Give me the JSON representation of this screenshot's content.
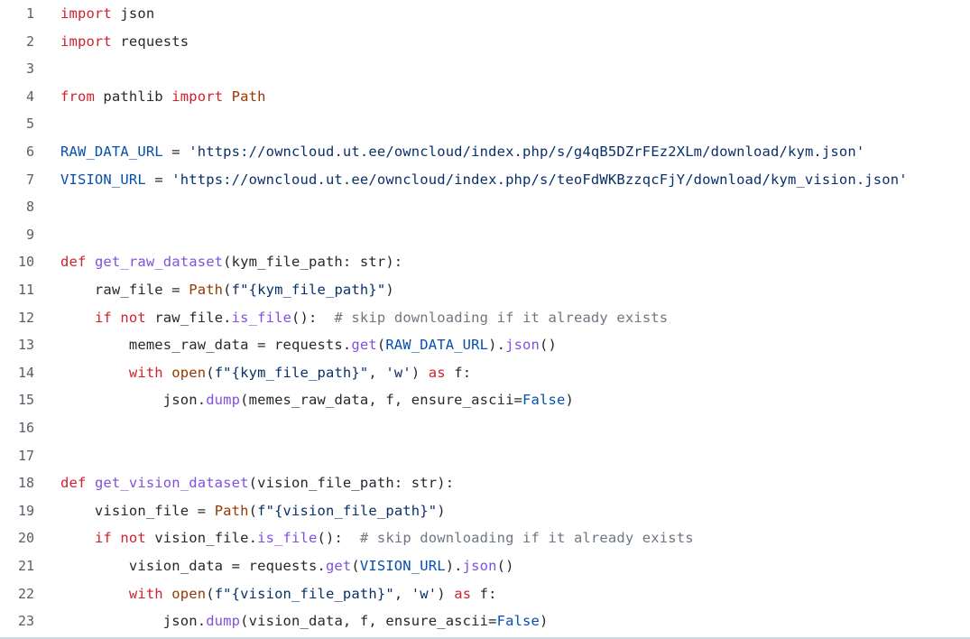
{
  "code_view": {
    "lines": [
      {
        "number": "1",
        "tokens": [
          {
            "text": "import",
            "kind": "keyword"
          },
          {
            "text": " json",
            "kind": "plain"
          }
        ]
      },
      {
        "number": "2",
        "tokens": [
          {
            "text": "import",
            "kind": "keyword"
          },
          {
            "text": " requests",
            "kind": "plain"
          }
        ]
      },
      {
        "number": "3",
        "tokens": []
      },
      {
        "number": "4",
        "tokens": [
          {
            "text": "from",
            "kind": "keyword"
          },
          {
            "text": " pathlib ",
            "kind": "plain"
          },
          {
            "text": "import",
            "kind": "keyword"
          },
          {
            "text": " Path",
            "kind": "builtin"
          }
        ]
      },
      {
        "number": "5",
        "tokens": []
      },
      {
        "number": "6",
        "tokens": [
          {
            "text": "RAW_DATA_URL",
            "kind": "constant"
          },
          {
            "text": " = ",
            "kind": "plain"
          },
          {
            "text": "'https://owncloud.ut.ee/owncloud/index.php/s/g4qB5DZrFEz2XLm/download/kym.json'",
            "kind": "string"
          }
        ]
      },
      {
        "number": "7",
        "tokens": [
          {
            "text": "VISION_URL",
            "kind": "constant"
          },
          {
            "text": " = ",
            "kind": "plain"
          },
          {
            "text": "'https://owncloud.ut.ee/owncloud/index.php/s/teoFdWKBzzqcFjY/download/kym_vision.json'",
            "kind": "string"
          }
        ]
      },
      {
        "number": "8",
        "tokens": []
      },
      {
        "number": "9",
        "tokens": []
      },
      {
        "number": "10",
        "tokens": [
          {
            "text": "def",
            "kind": "keyword"
          },
          {
            "text": " ",
            "kind": "plain"
          },
          {
            "text": "get_raw_dataset",
            "kind": "function"
          },
          {
            "text": "(kym_file_path: str):",
            "kind": "plain"
          }
        ]
      },
      {
        "number": "11",
        "tokens": [
          {
            "text": "    raw_file = ",
            "kind": "plain"
          },
          {
            "text": "Path",
            "kind": "builtin"
          },
          {
            "text": "(",
            "kind": "plain"
          },
          {
            "text": "f\"{kym_file_path}\"",
            "kind": "string"
          },
          {
            "text": ")",
            "kind": "plain"
          }
        ]
      },
      {
        "number": "12",
        "tokens": [
          {
            "text": "    ",
            "kind": "plain"
          },
          {
            "text": "if",
            "kind": "keyword"
          },
          {
            "text": " ",
            "kind": "plain"
          },
          {
            "text": "not",
            "kind": "keyword"
          },
          {
            "text": " raw_file.",
            "kind": "plain"
          },
          {
            "text": "is_file",
            "kind": "function"
          },
          {
            "text": "():  ",
            "kind": "plain"
          },
          {
            "text": "# skip downloading if it already exists",
            "kind": "comment"
          }
        ]
      },
      {
        "number": "13",
        "tokens": [
          {
            "text": "        memes_raw_data = requests.",
            "kind": "plain"
          },
          {
            "text": "get",
            "kind": "function"
          },
          {
            "text": "(",
            "kind": "plain"
          },
          {
            "text": "RAW_DATA_URL",
            "kind": "constant"
          },
          {
            "text": ").",
            "kind": "plain"
          },
          {
            "text": "json",
            "kind": "function"
          },
          {
            "text": "()",
            "kind": "plain"
          }
        ]
      },
      {
        "number": "14",
        "tokens": [
          {
            "text": "        ",
            "kind": "plain"
          },
          {
            "text": "with",
            "kind": "keyword"
          },
          {
            "text": " ",
            "kind": "plain"
          },
          {
            "text": "open",
            "kind": "builtin"
          },
          {
            "text": "(",
            "kind": "plain"
          },
          {
            "text": "f\"{kym_file_path}\"",
            "kind": "string"
          },
          {
            "text": ", ",
            "kind": "plain"
          },
          {
            "text": "'w'",
            "kind": "string"
          },
          {
            "text": ") ",
            "kind": "plain"
          },
          {
            "text": "as",
            "kind": "keyword"
          },
          {
            "text": " f:",
            "kind": "plain"
          }
        ]
      },
      {
        "number": "15",
        "tokens": [
          {
            "text": "            json.",
            "kind": "plain"
          },
          {
            "text": "dump",
            "kind": "function"
          },
          {
            "text": "(memes_raw_data, f, ensure_ascii=",
            "kind": "plain"
          },
          {
            "text": "False",
            "kind": "constant"
          },
          {
            "text": ")",
            "kind": "plain"
          }
        ]
      },
      {
        "number": "16",
        "tokens": []
      },
      {
        "number": "17",
        "tokens": []
      },
      {
        "number": "18",
        "tokens": [
          {
            "text": "def",
            "kind": "keyword"
          },
          {
            "text": " ",
            "kind": "plain"
          },
          {
            "text": "get_vision_dataset",
            "kind": "function"
          },
          {
            "text": "(vision_file_path: str):",
            "kind": "plain"
          }
        ]
      },
      {
        "number": "19",
        "tokens": [
          {
            "text": "    vision_file = ",
            "kind": "plain"
          },
          {
            "text": "Path",
            "kind": "builtin"
          },
          {
            "text": "(",
            "kind": "plain"
          },
          {
            "text": "f\"{vision_file_path}\"",
            "kind": "string"
          },
          {
            "text": ")",
            "kind": "plain"
          }
        ]
      },
      {
        "number": "20",
        "tokens": [
          {
            "text": "    ",
            "kind": "plain"
          },
          {
            "text": "if",
            "kind": "keyword"
          },
          {
            "text": " ",
            "kind": "plain"
          },
          {
            "text": "not",
            "kind": "keyword"
          },
          {
            "text": " vision_file.",
            "kind": "plain"
          },
          {
            "text": "is_file",
            "kind": "function"
          },
          {
            "text": "():  ",
            "kind": "plain"
          },
          {
            "text": "# skip downloading if it already exists",
            "kind": "comment"
          }
        ]
      },
      {
        "number": "21",
        "tokens": [
          {
            "text": "        vision_data = requests.",
            "kind": "plain"
          },
          {
            "text": "get",
            "kind": "function"
          },
          {
            "text": "(",
            "kind": "plain"
          },
          {
            "text": "VISION_URL",
            "kind": "constant"
          },
          {
            "text": ").",
            "kind": "plain"
          },
          {
            "text": "json",
            "kind": "function"
          },
          {
            "text": "()",
            "kind": "plain"
          }
        ]
      },
      {
        "number": "22",
        "tokens": [
          {
            "text": "        ",
            "kind": "plain"
          },
          {
            "text": "with",
            "kind": "keyword"
          },
          {
            "text": " ",
            "kind": "plain"
          },
          {
            "text": "open",
            "kind": "builtin"
          },
          {
            "text": "(",
            "kind": "plain"
          },
          {
            "text": "f\"{vision_file_path}\"",
            "kind": "string"
          },
          {
            "text": ", ",
            "kind": "plain"
          },
          {
            "text": "'w'",
            "kind": "string"
          },
          {
            "text": ") ",
            "kind": "plain"
          },
          {
            "text": "as",
            "kind": "keyword"
          },
          {
            "text": " f:",
            "kind": "plain"
          }
        ]
      },
      {
        "number": "23",
        "tokens": [
          {
            "text": "            json.",
            "kind": "plain"
          },
          {
            "text": "dump",
            "kind": "function"
          },
          {
            "text": "(vision_data, f, ensure_ascii=",
            "kind": "plain"
          },
          {
            "text": "False",
            "kind": "constant"
          },
          {
            "text": ")",
            "kind": "plain"
          }
        ]
      }
    ]
  },
  "colors": {
    "keyword": "#cf222e",
    "function": "#8250df",
    "builtin": "#953800",
    "string": "#0a3069",
    "constant": "#0550ae",
    "comment": "#6e7781",
    "plain": "#24292f",
    "line_number": "#57606a"
  }
}
